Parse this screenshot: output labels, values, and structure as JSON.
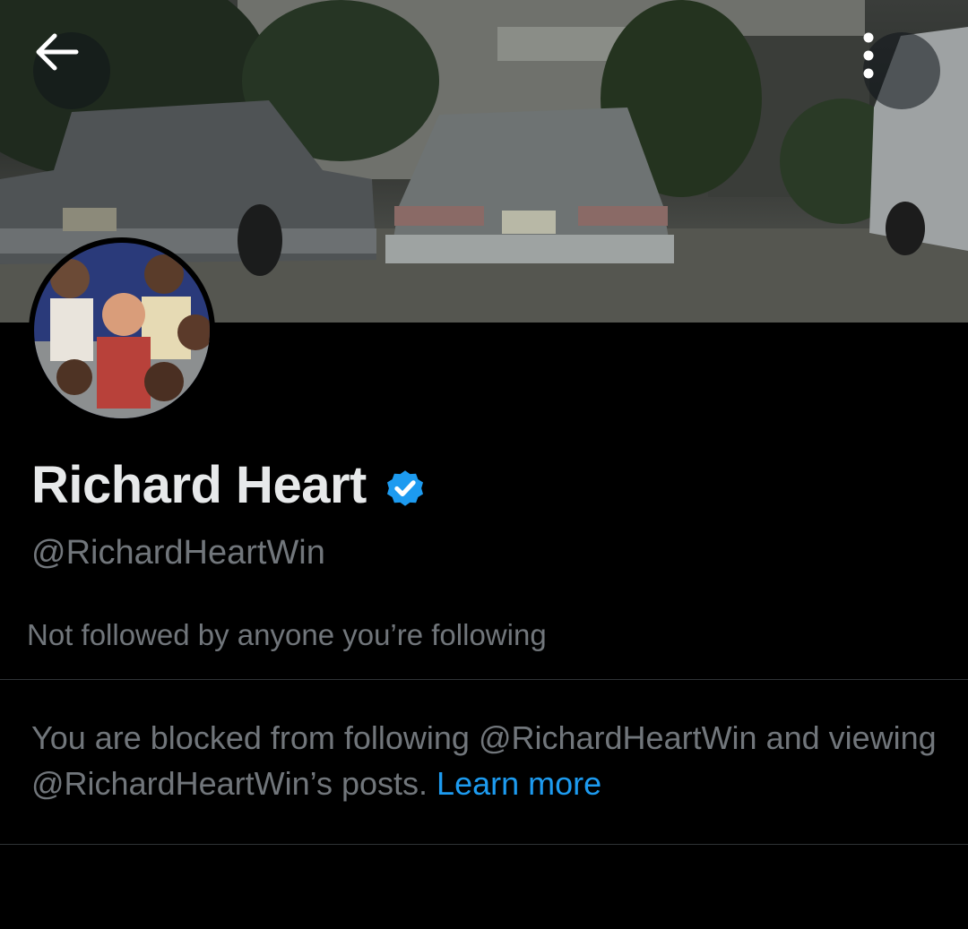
{
  "header": {
    "back_icon": "arrow-left-icon",
    "more_icon": "more-vertical-icon"
  },
  "profile": {
    "display_name": "Richard Heart",
    "verified_icon": "verified-badge-icon",
    "verified_color": "#1d9bf0",
    "handle": "@RichardHeartWin",
    "followed_by": "Not followed by anyone you’re following"
  },
  "blocked": {
    "message": "You are blocked from following @RichardHeartWin and viewing @RichardHeartWin’s posts.",
    "link_label": "Learn more"
  },
  "colors": {
    "background": "#000000",
    "primary_text": "#e7e9ea",
    "secondary_text": "#71767b",
    "link": "#1d9bf0",
    "divider": "#2f3336"
  }
}
